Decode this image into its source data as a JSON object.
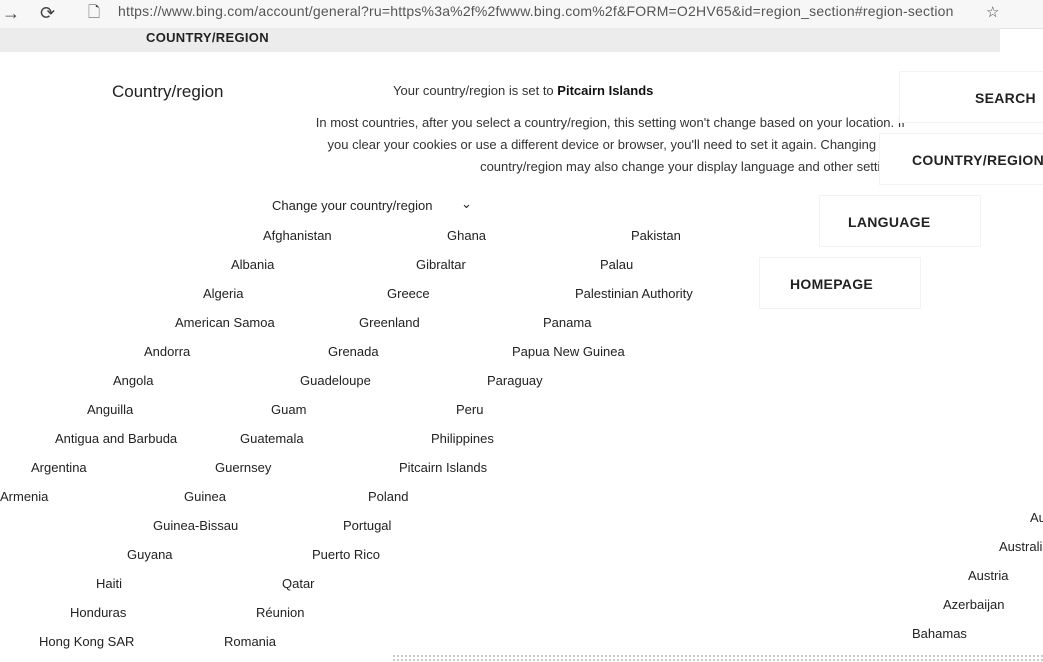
{
  "browser": {
    "url": "https://www.bing.com/account/general?ru=https%3a%2f%2fwww.bing.com%2f&FORM=O2HV65&id=region_section#region-section"
  },
  "page": {
    "section_heading": "COUNTRY/REGION",
    "settings_title": "Country/region",
    "status_prefix": "Your country/region is set to",
    "status_value": "Pitcairn Islands",
    "description": "In most countries, after you select a country/region, this setting won't change based on your location. If you clear your cookies or use a different device or browser, you'll need to set it again. Changing your country/region may also change your display language and other settings.",
    "change_label": "Change your country/region"
  },
  "countries": [
    "Afghanistan",
    "Albania",
    "Algeria",
    "American Samoa",
    "Andorra",
    "Angola",
    "Anguilla",
    "Antigua and Barbuda",
    "Argentina",
    "Armenia",
    "Guyana",
    "Haiti",
    "Honduras",
    "Hong Kong SAR",
    "Ghana",
    "Gibraltar",
    "Greece",
    "Greenland",
    "Grenada",
    "Guadeloupe",
    "Guam",
    "Guatemala",
    "Guernsey",
    "Guinea",
    "Guinea-Bissau",
    "Puerto Rico",
    "Qatar",
    "Réunion",
    "Romania",
    "Pakistan",
    "Palau",
    "Palestinian Authority",
    "Panama",
    "Papua New Guinea",
    "Paraguay",
    "Peru",
    "Philippines",
    "Pitcairn Islands",
    "Poland",
    "Portugal",
    "Australia",
    "Austria",
    "Azerbaijan",
    "Bahamas"
  ],
  "nav": {
    "search": "SEARCH",
    "country_region": "COUNTRY/REGION",
    "language": "LANGUAGE",
    "homepage": "HOMEPAGE"
  }
}
